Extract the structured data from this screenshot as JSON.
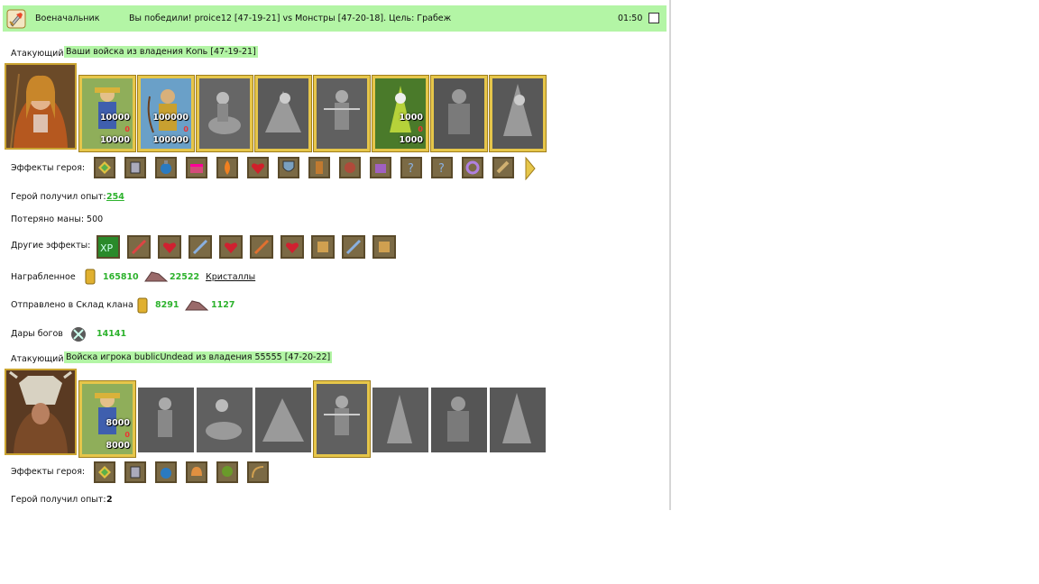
{
  "header": {
    "title": "Военачальник",
    "message": "Вы победили! proice12 [47-19-21] vs Монстры [47-20-18]. Цель: Грабеж",
    "time": "01:50"
  },
  "attacker1": {
    "role_label": "Атакующий",
    "army_label": "Ваши войска из владения Копь [47-19-21]",
    "units": [
      {
        "count_top": "10000",
        "count_bottom": "10000",
        "lost": "0"
      },
      {
        "count_top": "100000",
        "count_bottom": "100000",
        "lost": "0"
      },
      {
        "count_top": "",
        "count_bottom": "",
        "lost": ""
      },
      {
        "count_top": "",
        "count_bottom": "",
        "lost": ""
      },
      {
        "count_top": "",
        "count_bottom": "",
        "lost": ""
      },
      {
        "count_top": "1000",
        "count_bottom": "1000",
        "lost": "0"
      },
      {
        "count_top": "",
        "count_bottom": "",
        "lost": ""
      },
      {
        "count_top": "",
        "count_bottom": "",
        "lost": ""
      }
    ],
    "hero_effects_label": "Эффекты героя:",
    "hero_effect_icons": [
      "gem-icon",
      "armor-icon",
      "potion-icon",
      "chest-icon",
      "fire-icon",
      "heart-icon",
      "shield-icon",
      "scroll-icon",
      "mask-icon",
      "castle-icon",
      "question-icon",
      "question-icon",
      "ring-icon",
      "scroll-icon"
    ],
    "xp_label": "Герой получил опыт:",
    "xp_value": "254",
    "mana_label": "Потеряно маны: 500",
    "other_effects_label": "Другие эффекты:",
    "other_effect_icons": [
      "xp-icon",
      "sword-icon",
      "heart-icon",
      "sword-icon",
      "heart-icon",
      "sword-icon",
      "heart-icon",
      "scroll-icon",
      "sword-icon",
      "scroll-icon"
    ],
    "loot_label": "Награбленное",
    "loot_gold": "165810",
    "loot_ore": "22522",
    "loot_crystals": "Кристаллы",
    "clan_label": "Отправлено в Склад клана",
    "clan_gold": "8291",
    "clan_ore": "1127",
    "gods_label": "Дары богов",
    "gods_value": "14141"
  },
  "attacker2": {
    "role_label": "Атакующий",
    "army_label": "Войска игрока bublicUndead из владения 55555 [47-20-22]",
    "units": [
      {
        "count_top": "8000",
        "count_bottom": "8000",
        "lost": "0"
      }
    ],
    "hero_effects_label": "Эффекты героя:",
    "hero_effect_icons": [
      "gem-icon",
      "armor-icon",
      "potion-icon",
      "helmet-icon",
      "tree-icon",
      "bow-icon"
    ],
    "xp_label": "Герой получил опыт:",
    "xp_value": "2"
  },
  "colors": {
    "header_bg": "#b3f5a5",
    "value_green": "#2db22d",
    "frame_gold": "#e6c64a"
  }
}
